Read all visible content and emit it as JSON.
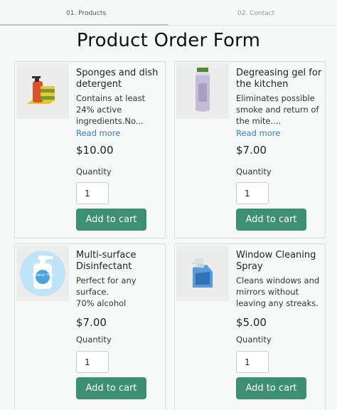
{
  "steps": [
    {
      "label": "01. Products"
    },
    {
      "label": "02. Contact"
    }
  ],
  "title": "Product Order Form",
  "products": [
    {
      "name": "Sponges and dish detergent",
      "desc": "Contains at least 24% active ingredients.No...",
      "more": "Read more",
      "price": "$10.00",
      "qty_label": "Quantity",
      "qty": "1",
      "button": "Add to cart",
      "icon": "sponge-detergent-icon"
    },
    {
      "name": "Degreasing gel for the kitchen",
      "desc": "Eliminates possible smoke and return of the mite....",
      "more": "Read more",
      "price": "$7.00",
      "qty_label": "Quantity",
      "qty": "1",
      "button": "Add to cart",
      "icon": "gel-bottle-icon"
    },
    {
      "name": "Multi-surface Disinfectant",
      "desc": "Perfect for any surface.\n70% alcohol",
      "price": "$7.00",
      "qty_label": "Quantity",
      "qty": "1",
      "button": "Add to cart",
      "icon": "alcohol-bottle-icon",
      "icon_text": "Alcohol 75%"
    },
    {
      "name": "Window Cleaning Spray",
      "desc": "Cleans windows and mirrors without leaving any streaks.",
      "price": "$5.00",
      "qty_label": "Quantity",
      "qty": "1",
      "button": "Add to cart",
      "icon": "spray-bottle-icon"
    }
  ],
  "colors": {
    "accent": "#3c8f73",
    "link": "#3b7fb5"
  }
}
